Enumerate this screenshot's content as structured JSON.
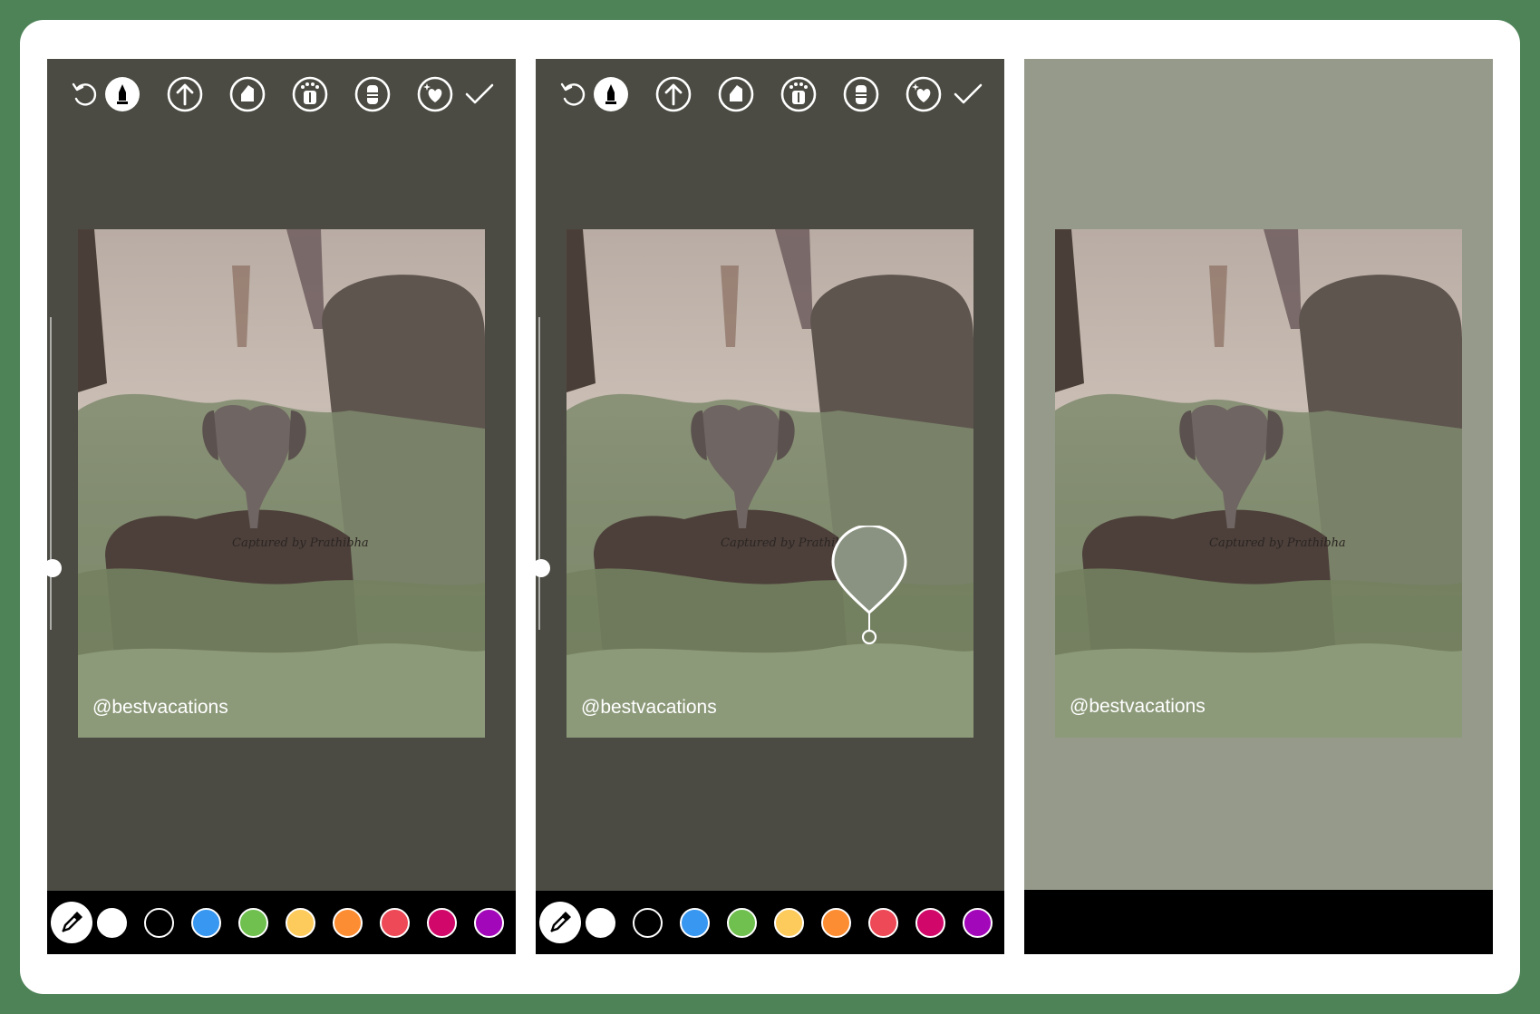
{
  "frame": {
    "background": "#4e8358",
    "card": "#ffffff"
  },
  "panels": [
    {
      "id": "before",
      "background": "#4b4b43",
      "handle": "@bestvacations",
      "has_toolbar": true,
      "has_palette": true
    },
    {
      "id": "picking",
      "background": "#4b4b43",
      "handle": "@bestvacations",
      "has_toolbar": true,
      "has_palette": true,
      "picked_color": "#8a9381"
    },
    {
      "id": "after",
      "background": "#959a8b",
      "handle": "@bestvacations",
      "has_toolbar": false,
      "has_palette": false
    }
  ],
  "toolbar": {
    "tools": [
      "undo-icon",
      "pen-icon",
      "arrow-up-icon",
      "marker-icon",
      "neon-icon",
      "eraser-icon",
      "sticker-heart-icon",
      "checkmark-icon"
    ]
  },
  "palette": {
    "picker_icon": "eyedropper-icon",
    "colors": [
      "#ffffff",
      "#000000",
      "#3897f0",
      "#70c050",
      "#fdcb5c",
      "#fd8d32",
      "#ed4956",
      "#d10869",
      "#a307ba"
    ]
  },
  "photo": {
    "watermark": "Captured by Prathibha",
    "alt": "baby elephant resting on another baby elephant in grass"
  }
}
